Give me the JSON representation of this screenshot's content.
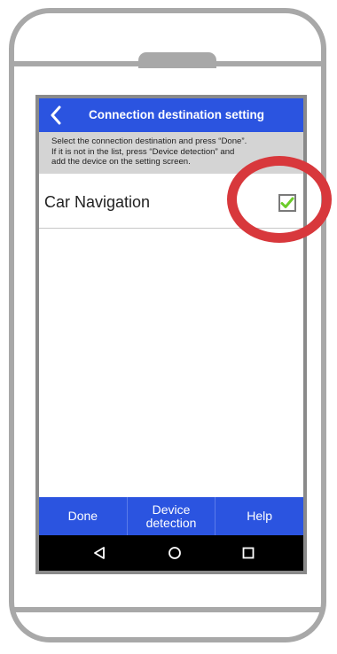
{
  "header": {
    "title": "Connection destination setting",
    "back_icon": "chevron-left-icon"
  },
  "instructions": {
    "line1": "Select the connection destination and press “Done”.",
    "line2": "If it is not in the list, press “Device detection” and",
    "line3": "add the device on the setting screen."
  },
  "list": {
    "items": [
      {
        "label": "Car Navigation",
        "checked": true
      }
    ]
  },
  "footer": {
    "done_label": "Done",
    "detection_label": "Device\ndetection",
    "help_label": "Help"
  },
  "nav": {
    "back_icon": "triangle-back-icon",
    "home_icon": "circle-home-icon",
    "recents_icon": "square-recents-icon"
  },
  "colors": {
    "accent_blue": "#2b54e0",
    "check_green": "#6ccc2a",
    "highlight_red": "#d8383c",
    "instruction_bg": "#d4d4d4"
  }
}
